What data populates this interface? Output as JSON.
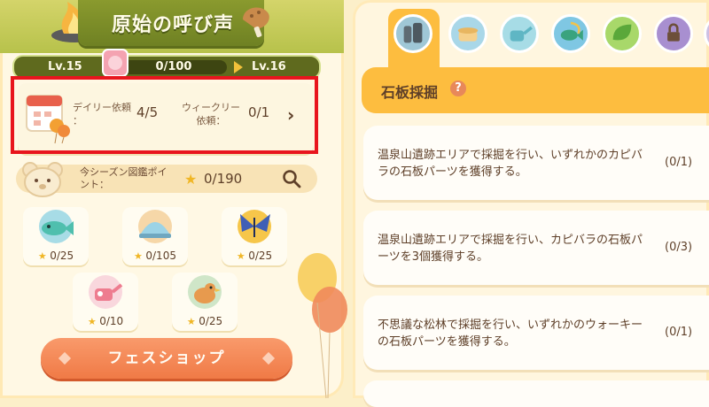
{
  "event": {
    "title": "原始の呼び声",
    "level_current": "Lv.15",
    "level_next": "Lv.16",
    "progress_text": "0/100",
    "progress_fraction": 0.0
  },
  "requests": {
    "daily_label": "デイリー依頼\n：",
    "daily_value": "4/5",
    "weekly_label": "ウィークリー\n依頼：",
    "weekly_value": "0/1",
    "chevron": "›"
  },
  "season": {
    "label": "今シーズン図鑑ポイ\nント：",
    "star": "★",
    "value": "0/190"
  },
  "codex": [
    {
      "icon": "fish-icon",
      "count": "0/25"
    },
    {
      "icon": "dish-icon",
      "count": "0/105"
    },
    {
      "icon": "butterfly-icon",
      "count": "0/25"
    },
    {
      "icon": "watering-can-icon",
      "count": "0/10"
    },
    {
      "icon": "bird-icon",
      "count": "0/25"
    }
  ],
  "shop": {
    "label": "フェスショップ"
  },
  "tabs": [
    {
      "icon": "stone-tablet-icon",
      "color": "#9fc7d6",
      "selected": true
    },
    {
      "icon": "cooking-pot-icon",
      "color": "#a9d7e8",
      "selected": false
    },
    {
      "icon": "watering-can-icon",
      "color": "#a7dce6",
      "selected": false
    },
    {
      "icon": "fish-icon",
      "color": "#7fc7e3",
      "selected": false
    },
    {
      "icon": "leaf-icon",
      "color": "#a8d86a",
      "selected": false
    },
    {
      "icon": "lock-icon",
      "color": "#a88fd0",
      "selected": false
    },
    {
      "icon": "more-icon",
      "color": "#cdbfe3",
      "selected": false
    }
  ],
  "section": {
    "title": "石板採掘",
    "help": "?"
  },
  "tasks": [
    {
      "text": "温泉山遺跡エリアで採掘を行い、いずれかのカピバラの石板パーツを獲得する。",
      "progress": "(0/1)"
    },
    {
      "text": "温泉山遺跡エリアで採掘を行い、カピバラの石板パーツを3個獲得する。",
      "progress": "(0/3)"
    },
    {
      "text": "不思議な松林で採掘を行い、いずれかのウォーキーの石板パーツを獲得する。",
      "progress": "(0/1)"
    }
  ],
  "colors": {
    "accent": "#fdbd3f",
    "shop": "#f07a46",
    "highlight": "#e8151d"
  }
}
